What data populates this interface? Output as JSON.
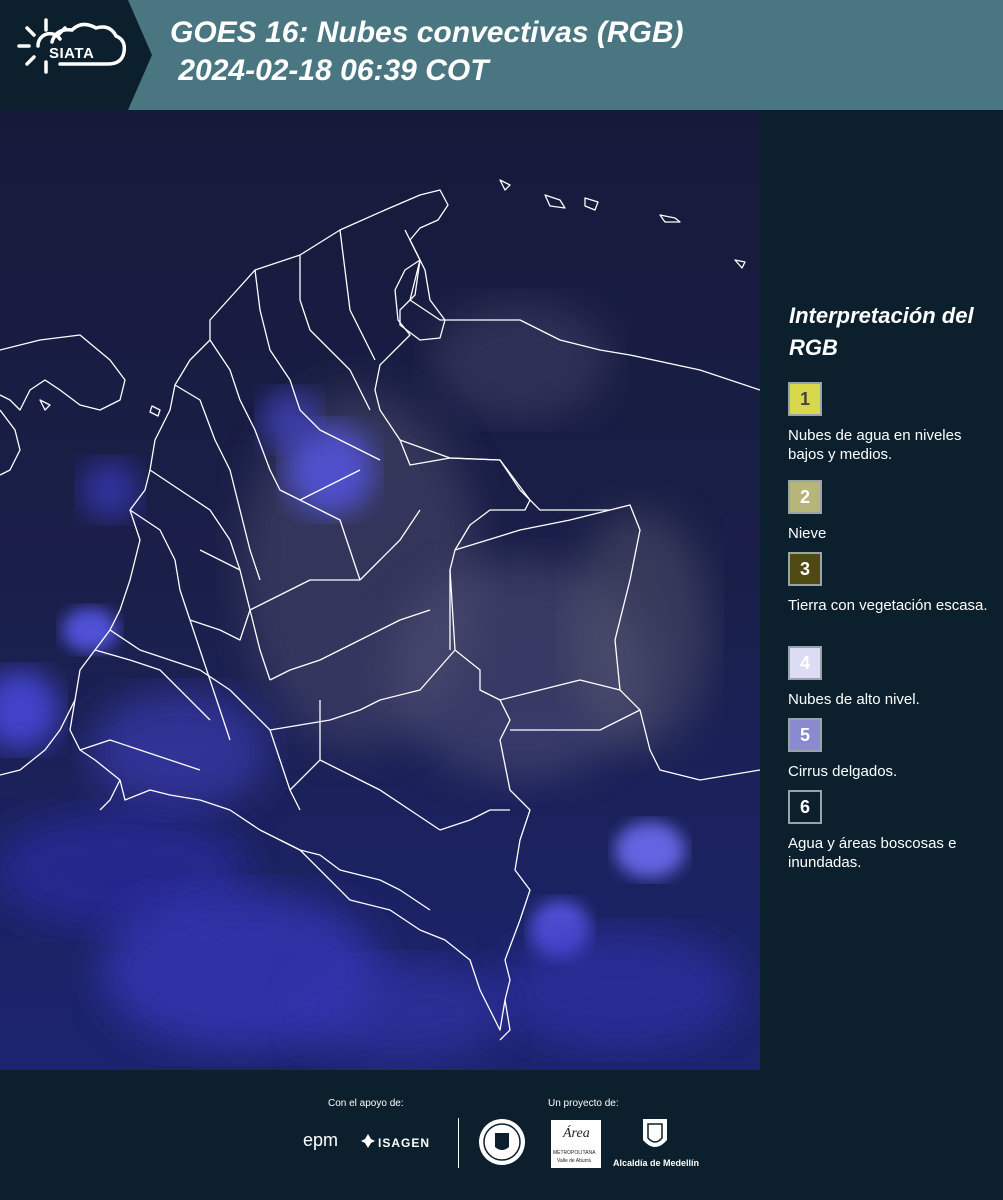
{
  "header": {
    "logo_text": "SIATA",
    "title_line1": "GOES 16: Nubes convectivas (RGB)",
    "title_line2": " 2024-02-18 06:39 COT"
  },
  "legend": {
    "title": "Interpretación del RGB",
    "items": [
      {
        "number": "1",
        "label": "Nubes de agua en niveles bajos y medios.",
        "color": "#d9d74c",
        "text_color": "#444444"
      },
      {
        "number": "2",
        "label": "Nieve",
        "color": "#b8b57a",
        "text_color": "#ffffff"
      },
      {
        "number": "3",
        "label": "Tierra con vegetación escasa.",
        "color": "#4f4a14",
        "text_color": "#ffffff"
      },
      {
        "number": "4",
        "label": "Nubes de alto nivel.",
        "color": "#dcdcf4",
        "text_color": "#ffffff"
      },
      {
        "number": "5",
        "label": "Cirrus delgados.",
        "color": "#8a8ad0",
        "text_color": "#ffffff"
      },
      {
        "number": "6",
        "label": "Agua y áreas boscosas e inundadas.",
        "color": "#0c1f2c",
        "text_color": "#ffffff"
      }
    ]
  },
  "footer": {
    "support_label": "Con el apoyo de:",
    "project_label": "Un proyecto de:",
    "epm": "epm",
    "isagen": "ISAGEN",
    "area_name": "Área",
    "area_sub1": "METROPOLITANA",
    "area_sub2": "Valle de Aburrá",
    "alcaldia": "Alcaldía de Medellín"
  }
}
